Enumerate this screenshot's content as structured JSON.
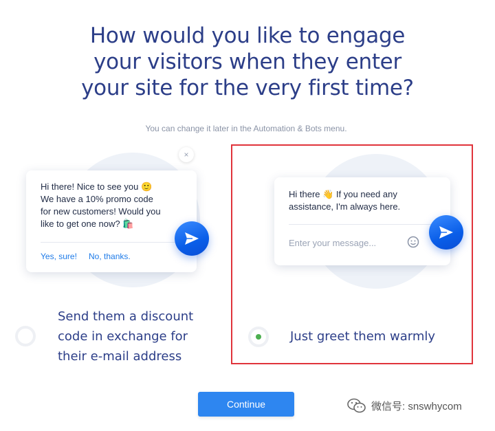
{
  "heading": {
    "line1": "How would you like to engage",
    "line2": "your visitors when they enter",
    "line3": "your site for the very first time?"
  },
  "subtitle": "You can change it later in the Automation & Bots menu.",
  "option_discount": {
    "message_line1": "Hi there! Nice to see you 🙂",
    "message_line2": "We have a 10% promo code",
    "message_line3": "for new customers! Would you",
    "message_line4": "like to get one now? 🛍️",
    "yes_label": "Yes, sure!",
    "no_label": "No, thanks.",
    "close_label": "×",
    "label_line1": "Send them a discount",
    "label_line2": "code in exchange for",
    "label_line3": "their e-mail address",
    "selected": false
  },
  "option_greet": {
    "message_line1": "Hi there 👋 If you need any",
    "message_line2": "assistance, I'm always here.",
    "input_placeholder": "Enter your message...",
    "label": "Just greet them warmly",
    "selected": true
  },
  "continue_label": "Continue",
  "watermark": "微信号: snswhycom",
  "colors": {
    "heading": "#2c3e88",
    "accent": "#2e86f0",
    "highlight_border": "#e0333a",
    "selected_dot": "#4caf50"
  }
}
